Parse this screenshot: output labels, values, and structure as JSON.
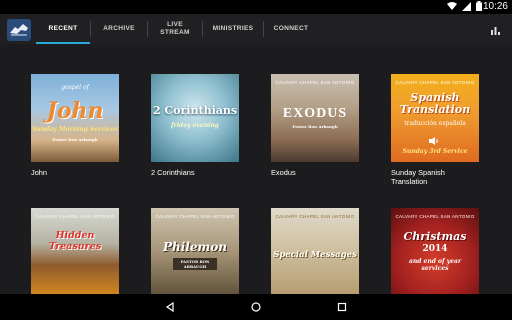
{
  "status": {
    "time": "10:26"
  },
  "nav": {
    "tabs": [
      {
        "label": "RECENT",
        "active": true
      },
      {
        "label": "ARCHIVE",
        "active": false
      },
      {
        "label": "LIVE\nSTREAM",
        "active": false
      },
      {
        "label": "MINISTRIES",
        "active": false
      },
      {
        "label": "CONNECT",
        "active": false
      }
    ]
  },
  "items": [
    {
      "caption": "John",
      "art": {
        "header": "gospel of",
        "title": "John",
        "subtitle": "Sunday Morning Services",
        "byline": "Pastor Ron Arbaugh"
      }
    },
    {
      "caption": "2 Corinthians",
      "art": {
        "title": "2 Corinthians",
        "subtitle": "friday evening"
      }
    },
    {
      "caption": "Exodus",
      "art": {
        "header": "CALVARY CHAPEL SAN ANTONIO",
        "title": "EXODUS",
        "byline": "Pastor Ron Arbaugh"
      }
    },
    {
      "caption": "Sunday Spanish Translation",
      "art": {
        "header": "CALVARY CHAPEL SAN ANTONIO",
        "title": "Spanish Translation",
        "subtitle": "traducción española",
        "footer": "Sunday 3rd Service"
      }
    },
    {
      "caption": "",
      "art": {
        "header": "CALVARY CHAPEL SAN ANTONIO",
        "title": "Hidden Treasures"
      }
    },
    {
      "caption": "",
      "art": {
        "header": "CALVARY CHAPEL SAN ANTONIO",
        "title": "Philemon",
        "byline": "PASTOR RON ARBAUGH"
      }
    },
    {
      "caption": "",
      "art": {
        "header": "CALVARY CHAPEL SAN ANTONIO",
        "title": "Special Messages"
      }
    },
    {
      "caption": "",
      "art": {
        "header": "CALVARY CHAPEL SAN ANTONIO",
        "title": "Christmas",
        "year": "2014",
        "subtitle": "and end of year services"
      }
    }
  ]
}
